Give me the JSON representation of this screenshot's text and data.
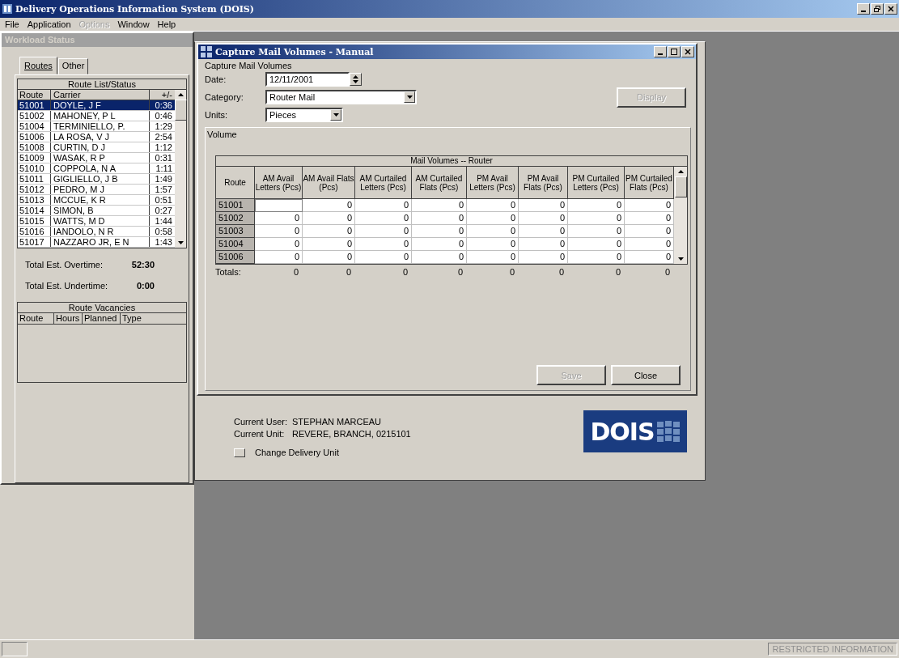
{
  "window": {
    "title": "Delivery Operations Information System (DOIS)"
  },
  "menu": [
    {
      "label": "File",
      "disabled": false
    },
    {
      "label": "Application",
      "disabled": false
    },
    {
      "label": "Options",
      "disabled": true
    },
    {
      "label": "Window",
      "disabled": false
    },
    {
      "label": "Help",
      "disabled": false
    }
  ],
  "workload_panel": {
    "title": "Workload Status",
    "tabs": [
      {
        "label": "Routes",
        "selected": true
      },
      {
        "label": "Other",
        "selected": false
      }
    ],
    "route_list": {
      "title": "Route List/Status",
      "columns": [
        "Route",
        "Carrier",
        "+/-"
      ],
      "rows": [
        {
          "route": "51001",
          "carrier": "DOYLE, J F",
          "hours": "0:36",
          "selected": true
        },
        {
          "route": "51002",
          "carrier": "MAHONEY, P L",
          "hours": "0:46",
          "selected": false
        },
        {
          "route": "51004",
          "carrier": "TERMINIELLO, P.",
          "hours": "1:29",
          "selected": false
        },
        {
          "route": "51006",
          "carrier": "LA ROSA, V J",
          "hours": "2:54",
          "selected": false
        },
        {
          "route": "51008",
          "carrier": "CURTIN, D J",
          "hours": "1:12",
          "selected": false
        },
        {
          "route": "51009",
          "carrier": "WASAK, R P",
          "hours": "0:31",
          "selected": false
        },
        {
          "route": "51010",
          "carrier": "COPPOLA, N A",
          "hours": "1:11",
          "selected": false
        },
        {
          "route": "51011",
          "carrier": "GIGLIELLO, J B",
          "hours": "1:49",
          "selected": false
        },
        {
          "route": "51012",
          "carrier": "PEDRO, M J",
          "hours": "1:57",
          "selected": false
        },
        {
          "route": "51013",
          "carrier": "MCCUE, K R",
          "hours": "0:51",
          "selected": false
        },
        {
          "route": "51014",
          "carrier": "SIMON, B",
          "hours": "0:27",
          "selected": false
        },
        {
          "route": "51015",
          "carrier": "WATTS, M D",
          "hours": "1:44",
          "selected": false
        },
        {
          "route": "51016",
          "carrier": "IANDOLO, N R",
          "hours": "0:58",
          "selected": false
        },
        {
          "route": "51017",
          "carrier": "NAZZARO JR, E N",
          "hours": "1:43",
          "selected": false
        }
      ]
    },
    "totals": [
      {
        "label": "Total Est. Overtime:",
        "value": "52:30"
      },
      {
        "label": "Total Est. Undertime:",
        "value": "0:00"
      }
    ],
    "vacancies": {
      "title": "Route Vacancies",
      "columns": [
        "Route",
        "Hours",
        "Planned",
        "Type"
      ]
    }
  },
  "background_window": {
    "current_user_label": "Current User:",
    "current_user": "STEPHAN MARCEAU",
    "current_unit_label": "Current Unit:",
    "current_unit": "REVERE, BRANCH, 0215101",
    "change_unit_button": "Change Delivery Unit",
    "logo": "DOIS"
  },
  "dialog": {
    "title": "Capture Mail Volumes - Manual",
    "group": "Capture Mail Volumes",
    "date": {
      "label": "Date:",
      "value": "12/11/2001"
    },
    "category": {
      "label": "Category:",
      "value": "Router Mail"
    },
    "units": {
      "label": "Units:",
      "value": "Pieces"
    },
    "display_button": {
      "label": "Display",
      "disabled": true
    },
    "volume_group": "Volume",
    "grid": {
      "title": "Mail Volumes -- Router",
      "columns": [
        "Route",
        "AM Avail Letters (Pcs)",
        "AM Avail Flats (Pcs)",
        "AM Curtailed Letters (Pcs)",
        "AM Curtailed Flats (Pcs)",
        "PM Avail Letters (Pcs)",
        "PM Avail Flats (Pcs)",
        "PM Curtailed Letters (Pcs)",
        "PM Curtailed Flats (Pcs)"
      ],
      "rows": [
        {
          "cells": [
            "51001",
            "",
            "0",
            "0",
            "0",
            "0",
            "0",
            "0",
            "0"
          ]
        },
        {
          "cells": [
            "51002",
            "0",
            "0",
            "0",
            "0",
            "0",
            "0",
            "0",
            "0"
          ]
        },
        {
          "cells": [
            "51003",
            "0",
            "0",
            "0",
            "0",
            "0",
            "0",
            "0",
            "0"
          ]
        },
        {
          "cells": [
            "51004",
            "0",
            "0",
            "0",
            "0",
            "0",
            "0",
            "0",
            "0"
          ]
        },
        {
          "cells": [
            "51006",
            "0",
            "0",
            "0",
            "0",
            "0",
            "0",
            "0",
            "0"
          ]
        }
      ],
      "totals": [
        "Totals:",
        "0",
        "0",
        "0",
        "0",
        "0",
        "0",
        "0",
        "0"
      ]
    },
    "buttons": [
      {
        "label": "Save",
        "disabled": true
      },
      {
        "label": "Close",
        "disabled": false
      }
    ]
  },
  "status_bar": {
    "right": "RESTRICTED INFORMATION"
  }
}
